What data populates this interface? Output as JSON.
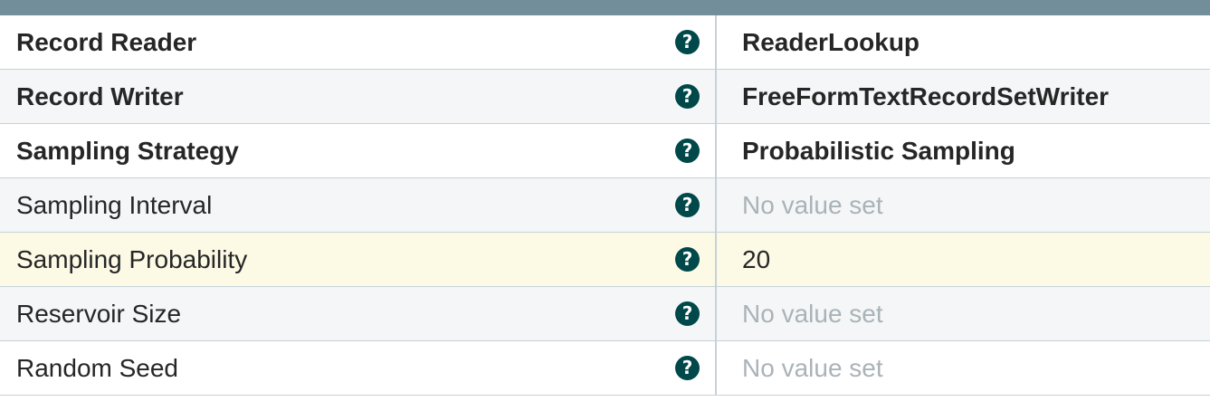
{
  "help_icon_glyph": "?",
  "colors": {
    "header_bar": "#728e9b",
    "help_icon": "#004849",
    "highlight_row": "#fcf9e5",
    "unset_value": "#aab3b8"
  },
  "properties": [
    {
      "name": "Record Reader",
      "value": "ReaderLookup",
      "required": true,
      "unset": false
    },
    {
      "name": "Record Writer",
      "value": "FreeFormTextRecordSetWriter",
      "required": true,
      "unset": false
    },
    {
      "name": "Sampling Strategy",
      "value": "Probabilistic Sampling",
      "required": true,
      "unset": false
    },
    {
      "name": "Sampling Interval",
      "value": "No value set",
      "required": false,
      "unset": true
    },
    {
      "name": "Sampling Probability",
      "value": "20",
      "required": false,
      "unset": false,
      "highlighted": true
    },
    {
      "name": "Reservoir Size",
      "value": "No value set",
      "required": false,
      "unset": true
    },
    {
      "name": "Random Seed",
      "value": "No value set",
      "required": false,
      "unset": true
    }
  ]
}
